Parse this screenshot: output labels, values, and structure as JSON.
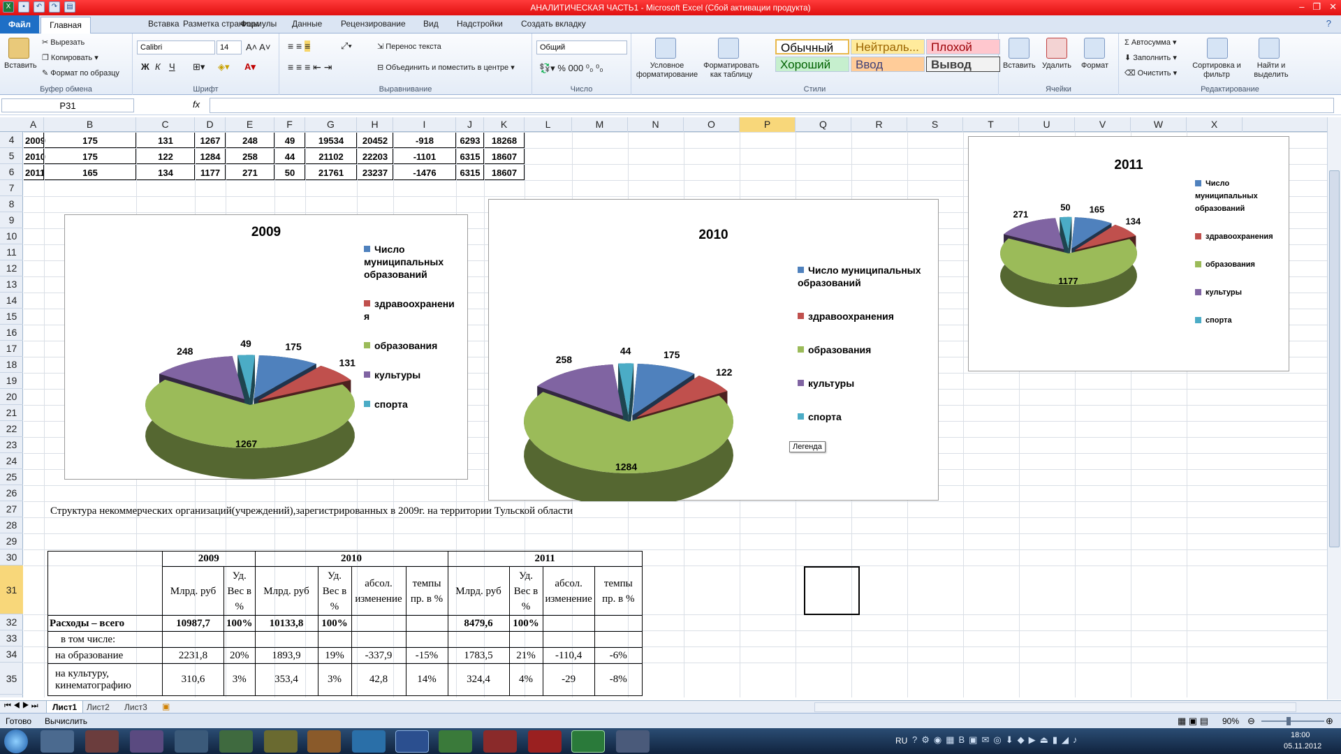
{
  "window": {
    "title": "АНАЛИТИЧЕСКАЯ ЧАСТЬ1 - Microsoft Excel (Сбой активации продукта)"
  },
  "tabs": [
    "Файл",
    "Главная",
    "Вставка",
    "Разметка страницы",
    "Формулы",
    "Данные",
    "Рецензирование",
    "Вид",
    "Надстройки",
    "Создать вкладку"
  ],
  "ribbon": {
    "clipboard": {
      "paste": "Вставить",
      "cut": "Вырезать",
      "copy": "Копировать",
      "format_painter": "Формат по образцу",
      "label": "Буфер обмена"
    },
    "font": {
      "name": "Calibri",
      "size": "14",
      "label": "Шрифт",
      "bold": "Ж",
      "italic": "К",
      "underline": "Ч"
    },
    "alignment": {
      "wrap": "Перенос текста",
      "merge": "Объединить и поместить в центре",
      "label": "Выравнивание"
    },
    "number": {
      "format": "Общий",
      "label": "Число"
    },
    "styles": {
      "conditional": "Условное форматирование",
      "as_table": "Форматировать как таблицу",
      "normal": "Обычный",
      "neutral": "Нейтраль...",
      "bad": "Плохой",
      "good": "Хороший",
      "input": "Ввод",
      "output": "Вывод",
      "label": "Стили"
    },
    "cells": {
      "insert": "Вставить",
      "delete": "Удалить",
      "format": "Формат",
      "label": "Ячейки"
    },
    "editing": {
      "autosum": "Автосумма",
      "fill": "Заполнить",
      "clear": "Очистить",
      "sort": "Сортировка и фильтр",
      "find": "Найти и выделить",
      "label": "Редактирование"
    }
  },
  "formula_bar": {
    "name_box": "P31",
    "fx": "fx",
    "formula": ""
  },
  "columns": [
    "A",
    "B",
    "C",
    "D",
    "E",
    "F",
    "G",
    "H",
    "I",
    "J",
    "K",
    "L",
    "M",
    "N",
    "O",
    "P",
    "Q",
    "R",
    "S",
    "T",
    "U",
    "V",
    "W",
    "X"
  ],
  "rows": [
    "4",
    "5",
    "6",
    "7",
    "8",
    "9",
    "10",
    "11",
    "12",
    "13",
    "14",
    "15",
    "16",
    "17",
    "18",
    "19",
    "20",
    "21",
    "22",
    "23",
    "24",
    "25",
    "26",
    "27",
    "28",
    "29",
    "30",
    "31",
    "32",
    "33",
    "34",
    "35"
  ],
  "top_table": [
    [
      "2009",
      "175",
      "131",
      "1267",
      "248",
      "49",
      "19534",
      "20452",
      "-918",
      "6293",
      "18268"
    ],
    [
      "2010",
      "175",
      "122",
      "1284",
      "258",
      "44",
      "21102",
      "22203",
      "-1101",
      "6315",
      "18607"
    ],
    [
      "2011",
      "165",
      "134",
      "1177",
      "271",
      "50",
      "21761",
      "23237",
      "-1476",
      "6315",
      "18607"
    ]
  ],
  "chart_data": [
    {
      "type": "pie",
      "title": "2009",
      "categories": [
        "Число муниципальных образований",
        "здравоохранения",
        "образования",
        "культуры",
        "спорта"
      ],
      "values": [
        175,
        131,
        1267,
        248,
        49
      ]
    },
    {
      "type": "pie",
      "title": "2010",
      "categories": [
        "Число муниципальных образований",
        "здравоохранения",
        "образования",
        "культуры",
        "спорта"
      ],
      "values": [
        175,
        122,
        1284,
        258,
        44
      ]
    },
    {
      "type": "pie",
      "title": "2011",
      "categories": [
        "Число муниципальных образований",
        "здравоохранения",
        "образования",
        "культуры",
        "спорта"
      ],
      "values": [
        165,
        134,
        1177,
        271,
        50
      ]
    }
  ],
  "legend_labels": {
    "c2009": [
      "Число муниципальных образований",
      "здравоохранени я",
      "образования",
      "культуры",
      "спорта"
    ],
    "c2010": [
      "Число муниципальных образований",
      "здравоохранения",
      "образования",
      "культуры",
      "спорта"
    ],
    "c2011": [
      "Число муниципальных образований",
      "здравоохранения",
      "образования",
      "культуры",
      "спорта"
    ]
  },
  "series_colors": [
    "#4f81bd",
    "#c0504d",
    "#9bbb59",
    "#8064a2",
    "#4bacc6"
  ],
  "tooltip": "Легенда",
  "caption": "Структура некоммерческих организаций(учреждений),зарегистрированных в 2009г. на территории Тульской области",
  "table2": {
    "years": [
      "2009",
      "2010",
      "2011"
    ],
    "sub": [
      "Млрд. руб",
      "Уд. Вес в %",
      "Млрд. руб",
      "Уд. Вес в %",
      "абсол. изменение",
      "темпы пр. в %",
      "Млрд. руб",
      "Уд. Вес в %",
      "абсол. изменение",
      "темпы пр. в %"
    ],
    "rows": [
      [
        "Расходы – всего",
        "10987,7",
        "100%",
        "10133,8",
        "100%",
        "",
        "",
        "8479,6",
        "100%",
        "",
        ""
      ],
      [
        "в том числе:",
        "",
        "",
        "",
        "",
        "",
        "",
        "",
        "",
        "",
        ""
      ],
      [
        "на образование",
        "2231,8",
        "20%",
        "1893,9",
        "19%",
        "-337,9",
        "-15%",
        "1783,5",
        "21%",
        "-110,4",
        "-6%"
      ],
      [
        "на культуру, кинематографию",
        "310,6",
        "3%",
        "353,4",
        "3%",
        "42,8",
        "14%",
        "324,4",
        "4%",
        "-29",
        "-8%"
      ]
    ]
  },
  "sheet_tabs": [
    "Лист1",
    "Лист2",
    "Лист3"
  ],
  "status": {
    "ready": "Готово",
    "calc": "Вычислить",
    "zoom": "90%"
  },
  "taskbar": {
    "lang": "RU",
    "time": "18:00",
    "date": "05.11.2012"
  }
}
